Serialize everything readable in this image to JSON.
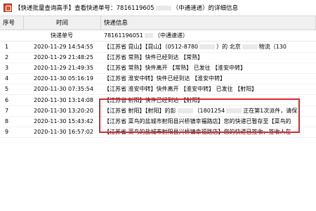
{
  "window": {
    "title_prefix": "【快递批量查询高手】查看快递单号：7816119605",
    "title_suffix": "（中通速递）的详细信息"
  },
  "table": {
    "headers": {
      "num": "序号",
      "time": "时间",
      "info": "快递信息"
    },
    "subheader": {
      "time": "快递单号",
      "info_prefix": "78161196051",
      "info_suffix": "（中通速递）"
    },
    "rows": [
      {
        "num": "1",
        "time": "2020-11-29 14:54:55",
        "info_a": "【江苏省 昆山】【昆山】（0512-8780",
        "info_b": "）的 北京",
        "info_c": "物流（130"
      },
      {
        "num": "2",
        "time": "2020-11-29 21:48:25",
        "info_a": "【江苏省 常熟】快件已经到达 【常熟】",
        "info_b": "",
        "info_c": ""
      },
      {
        "num": "3",
        "time": "2020-11-29 21:49:35",
        "info_a": "【江苏省 常熟】快件离开 【常熟】 已发往 【淮安中转】",
        "info_b": "",
        "info_c": ""
      },
      {
        "num": "4",
        "time": "2020-11-30 05:16:19",
        "info_a": "【江苏省 淮安中转】快件已经到达 【淮安中转】",
        "info_b": "",
        "info_c": ""
      },
      {
        "num": "5",
        "time": "2020-11-30 07:35:54",
        "info_a": "【江苏省 淮安中转】快件离开 【淮安中转】 已发往 【射阳】",
        "info_b": "",
        "info_c": ""
      },
      {
        "num": "6",
        "time": "2020-11-30 13:14:08",
        "info_a": "【江苏省 射阳】快件已经到达 【射阳】",
        "info_b": "",
        "info_c": ""
      },
      {
        "num": "7",
        "time": "2020-11-30 13:20:20",
        "info_a": "【江苏省 射阳】【射阳】的彭",
        "info_b": "（1801254",
        "info_c": "正在第1次派件，请保"
      },
      {
        "num": "8",
        "time": "2020-11-30 15:43:42",
        "info_a": "【江苏省 菜鸟的盐城市射阳县兴桥镇幸福路店】您的快递已暂存至【菜鸟的",
        "info_b": "",
        "info_c": ""
      },
      {
        "num": "9",
        "time": "2020-11-30 16:57:02",
        "info_a": "【江苏省 菜鸟的盐城市射阳县兴桥镇幸福路店】您的快递已签收，签收人在",
        "info_b": "",
        "info_c": ""
      }
    ]
  },
  "colors": {
    "highlight": "#e0262e",
    "header_bg": "#f0f0f0"
  }
}
